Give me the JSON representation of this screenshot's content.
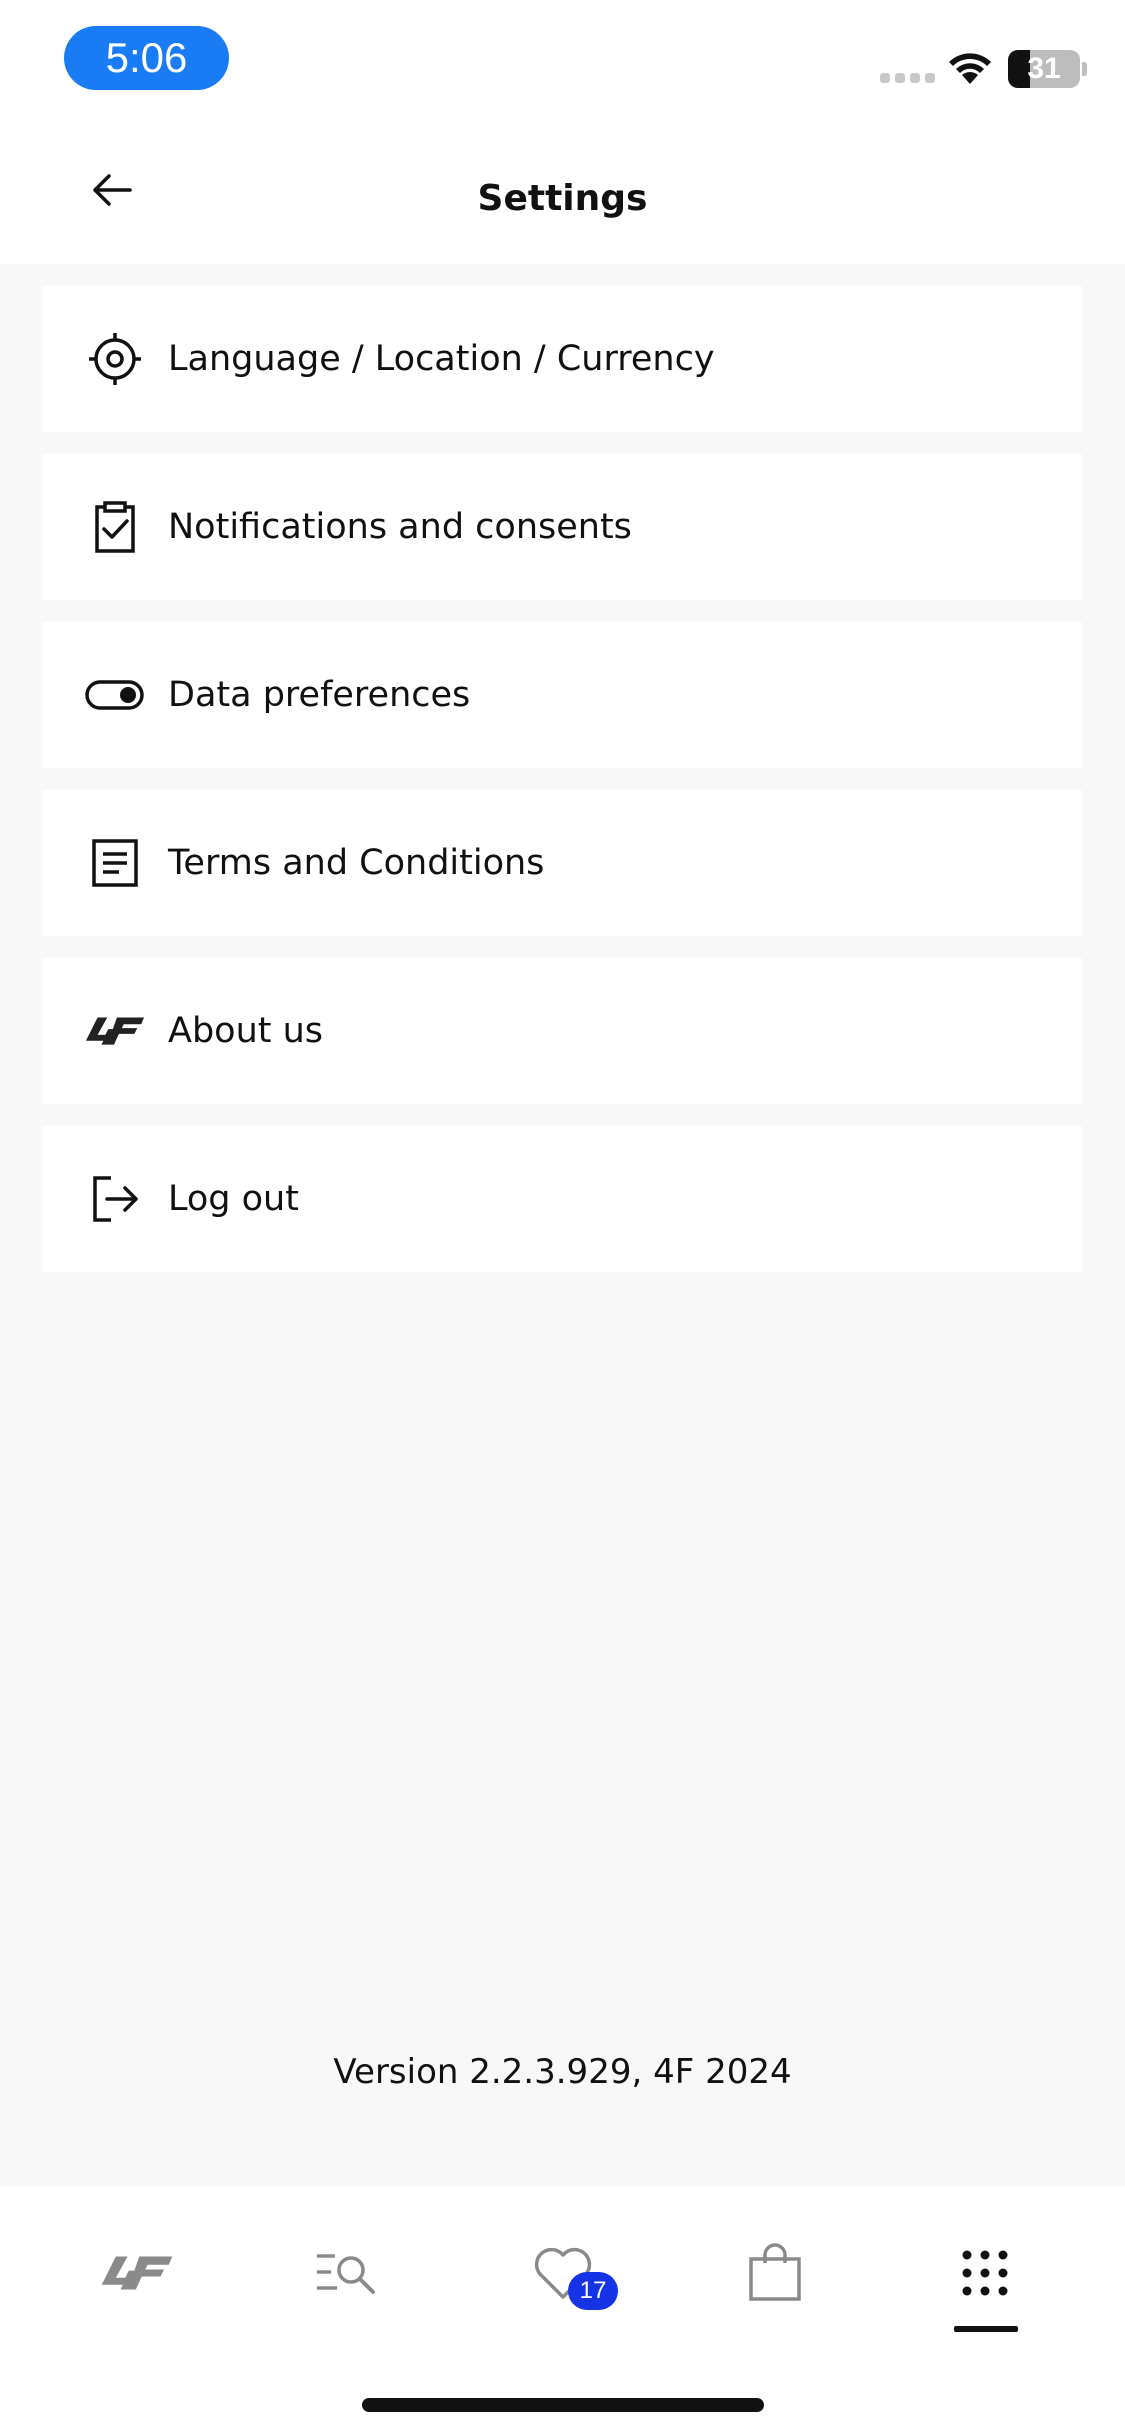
{
  "status_bar": {
    "time": "5:06",
    "battery_percent": "31",
    "battery_level": 0.31
  },
  "header": {
    "title": "Settings"
  },
  "menu": {
    "items": [
      {
        "label": "Language / Location / Currency",
        "icon": "target-icon"
      },
      {
        "label": "Notifications and consents",
        "icon": "clipboard-check-icon"
      },
      {
        "label": "Data preferences",
        "icon": "toggle-icon"
      },
      {
        "label": "Terms and Conditions",
        "icon": "document-icon"
      },
      {
        "label": "About us",
        "icon": "4f-logo-icon"
      },
      {
        "label": "Log out",
        "icon": "logout-icon"
      }
    ]
  },
  "footer": {
    "version": "Version 2.2.3.929, 4F 2024"
  },
  "tabbar": {
    "tabs": [
      {
        "name": "home",
        "icon": "4f-logo-icon"
      },
      {
        "name": "search",
        "icon": "search-menu-icon"
      },
      {
        "name": "favorites",
        "icon": "heart-icon",
        "badge": "17"
      },
      {
        "name": "cart",
        "icon": "shopping-bag-icon"
      },
      {
        "name": "more",
        "icon": "grid-dots-icon",
        "active": true
      }
    ]
  },
  "colors": {
    "time_pill": "#1a7cf5",
    "badge": "#1733e6",
    "background": "#f8f8f8"
  }
}
